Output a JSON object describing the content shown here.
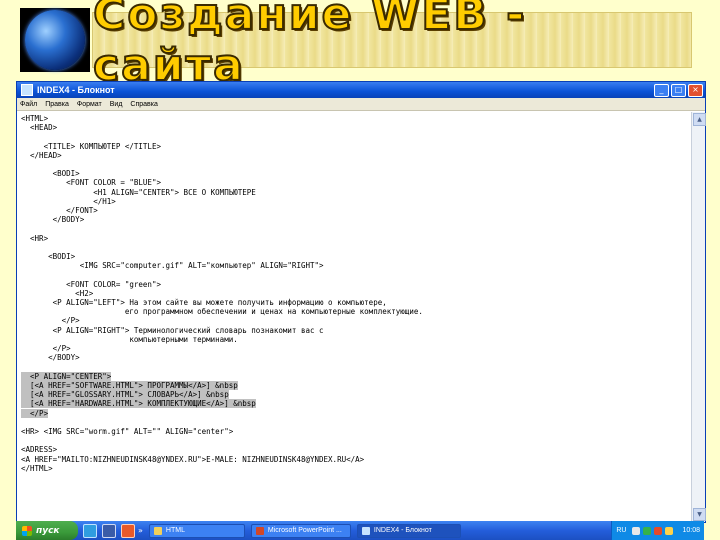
{
  "banner": {
    "title": "Создание WEB - сайта"
  },
  "window": {
    "title": "INDEX4 - Блокнот",
    "controls": {
      "minimize": "_",
      "maximize": "□",
      "close": "×"
    },
    "menu": [
      "Файл",
      "Правка",
      "Формат",
      "Вид",
      "Справка"
    ]
  },
  "editor": {
    "before_selection": "<HTML>\n  <HEAD>\n\n     <TITLE> КОМПЬЮТЕР </TITLE>\n  </HEAD>\n\n       <BODI>\n          <FONT COLOR = \"BLUE\">\n                <H1 ALIGN=\"CENTER\"> ВСЕ О КОМПЬЮТЕРЕ\n                </H1>\n          </FONT>\n       </BODY>\n\n  <HR>\n\n      <BODI>\n             <IMG SRC=\"computer.gif\" ALT=\"компьютер\" ALIGN=\"RIGHT\">\n\n          <FONT COLOR= \"green\">\n            <H2>\n       <P ALIGN=\"LEFT\"> На этом сайте вы можете получить информацию о компьютере,\n                       его программном обеспечении и ценах на компьютерные комплектующие.\n         </P>\n       <P ALIGN=\"RIGHT\"> Терминологический словарь познакомит вас с\n                        компьютерными терминами.\n       </P>\n      </BODY>\n\n",
    "selection": "  <P ALIGN=\"CENTER\">\n  [<A HREF=\"SOFTWARE.HTML\"> ПРОГРАММЫ</A>] &nbsp\n  [<A HREF=\"GLOSSARY.HTML\"> СЛОВАРЬ</A>] &nbsp\n  [<A HREF=\"HARDWARE.HTML\"> КОМПЛЕКТУЮЩИЕ</A>] &nbsp\n  </P>",
    "after_selection": "\n\n<HR> <IMG SRC=\"worm.gif\" ALT=\"\" ALIGN=\"center\">\n\n<ADRESS>\n<A HREF=\"MAILTO:NIZHNEUDINSK48@YNDEX.RU\">E-MALE: NIZHNEUDINSK48@YNDEX.RU</A>\n</HTML>"
  },
  "taskbar": {
    "start_label": "пуск",
    "quicklaunch_more": "»",
    "tasks": [
      {
        "label": "HTML",
        "active": false
      },
      {
        "label": "Microsoft PowerPoint ...",
        "active": false
      },
      {
        "label": "INDEX4 - Блокнот",
        "active": true
      }
    ],
    "language": "RU",
    "clock": "10:08"
  },
  "colors": {
    "titlebar": "#0a52d6",
    "taskbar": "#245edb",
    "start": "#3a9a3a",
    "slide_bg": "#ffffcc",
    "banner_text": "#ffcc00"
  }
}
